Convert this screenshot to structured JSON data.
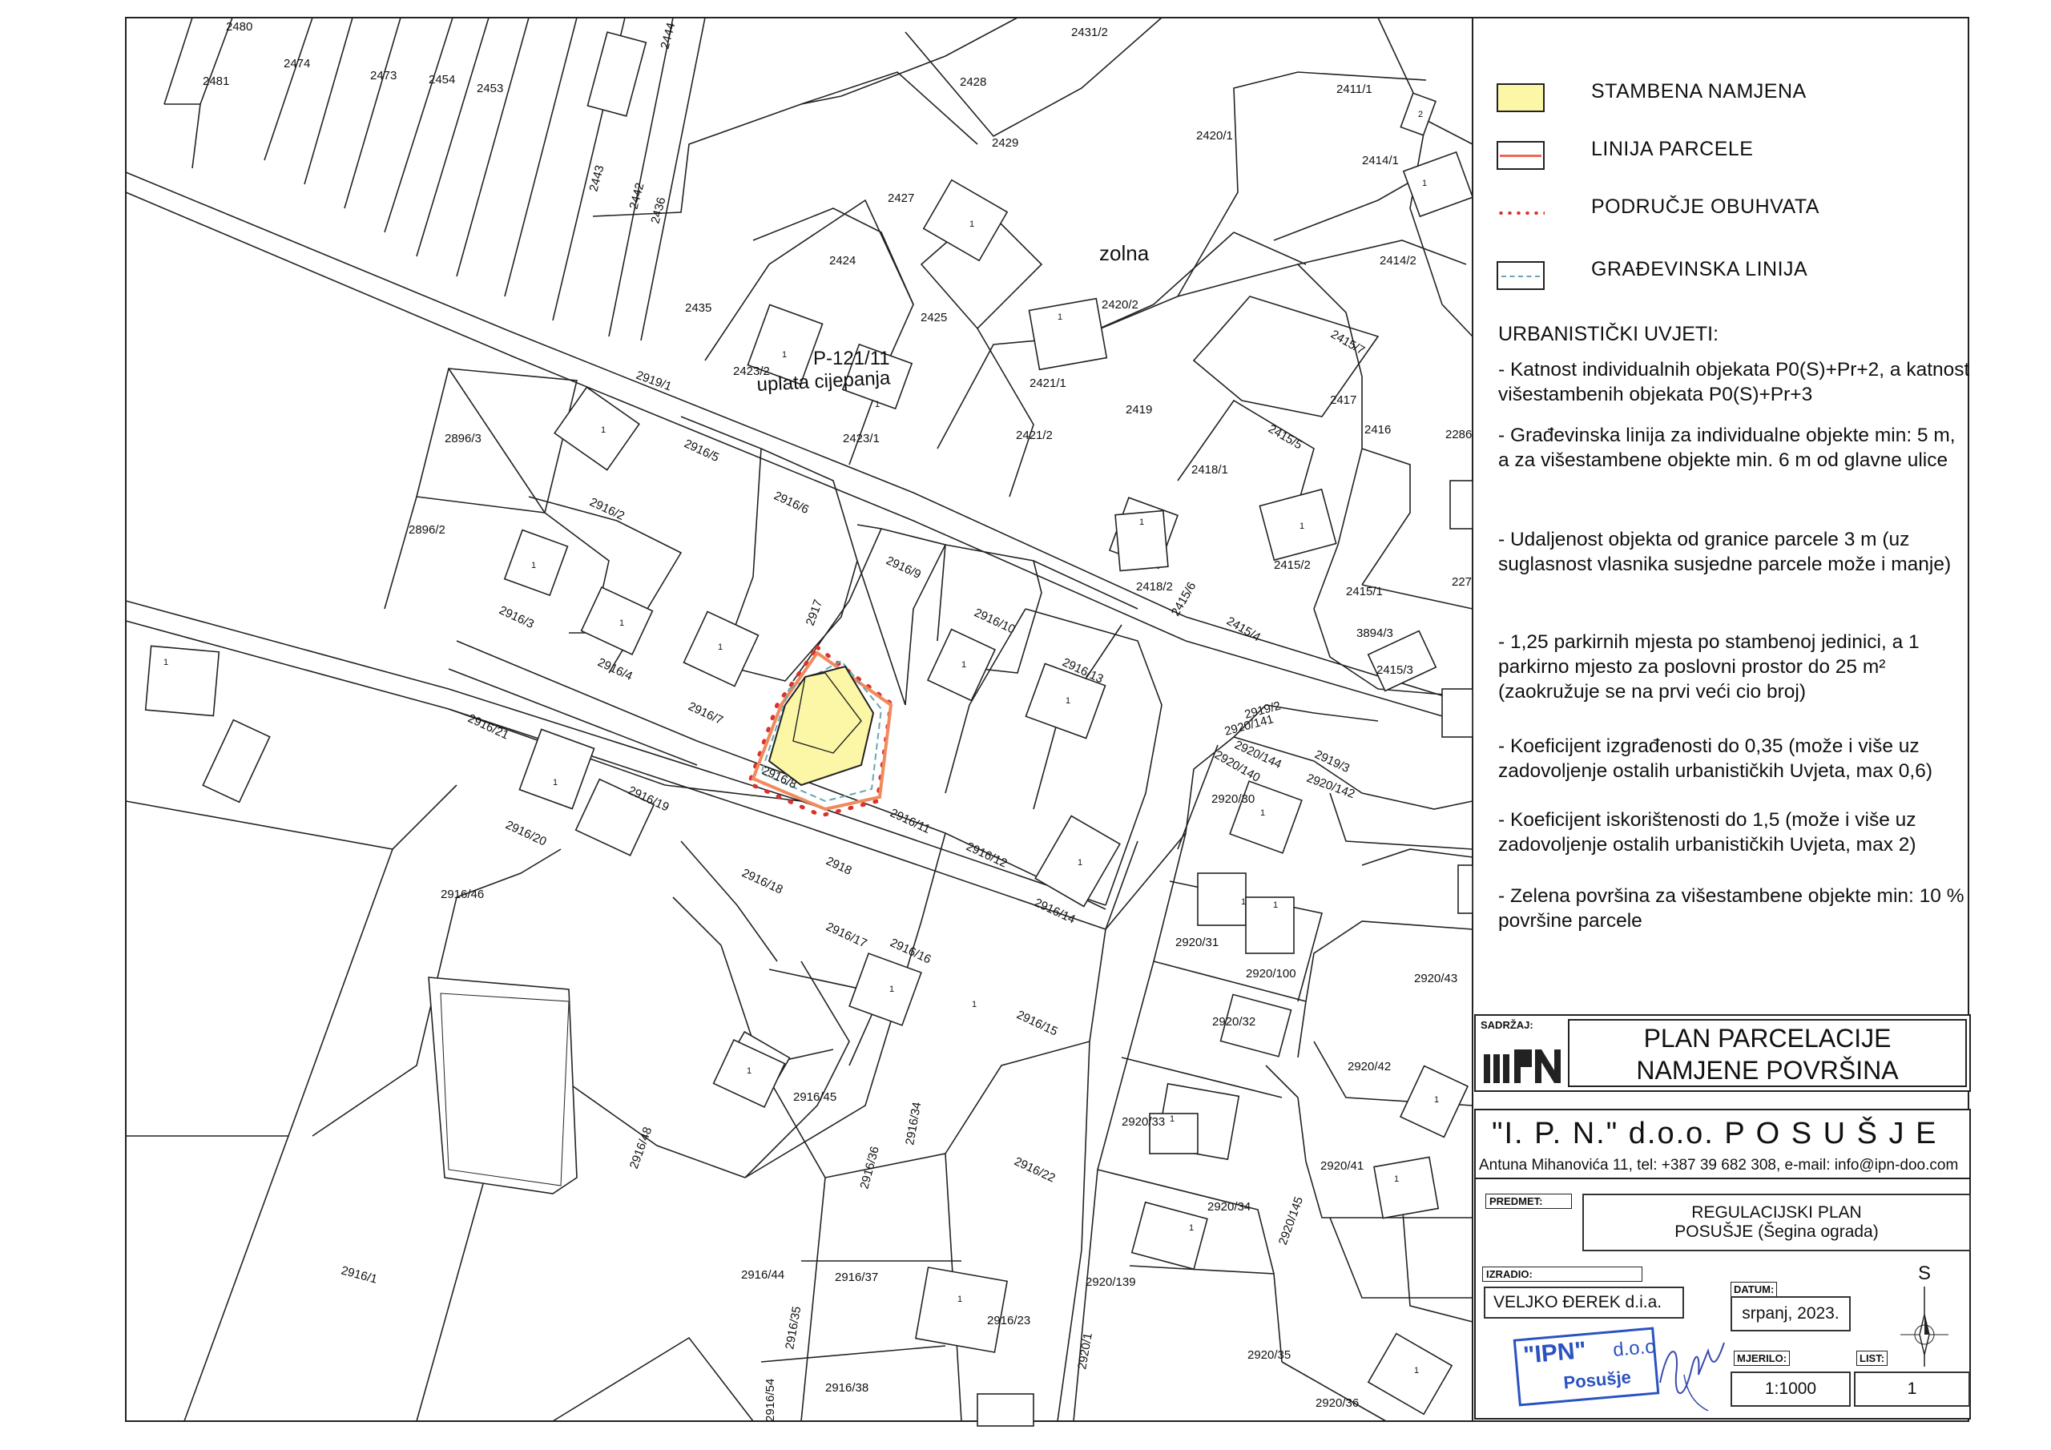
{
  "legend": {
    "items": [
      {
        "label": "STAMBENA NAMJENA",
        "symbol": "yellow-fill"
      },
      {
        "label": "LINIJA PARCELE",
        "symbol": "red-line"
      },
      {
        "label": "PODRUČJE OBUHVATA",
        "symbol": "red-dotted"
      },
      {
        "label": "GRAĐEVINSKA LINIJA",
        "symbol": "dashed-line"
      }
    ],
    "conditions_title": "URBANISTIČKI UVJETI:",
    "conditions": [
      "- Katnost individualnih objekata P0(S)+Pr+2, a katnost višestambenih objekata P0(S)+Pr+3",
      "- Građevinska linija za individualne objekte min: 5 m, a za višestambene objekte min. 6 m od glavne ulice",
      "- Udaljenost objekta od granice parcele 3 m (uz suglasnost vlasnika susjedne parcele može i manje)",
      "- 1,25 parkirnih mjesta po stambenoj jedinici, a 1 parkirno mjesto za poslovni prostor do 25 m² (zaokružuje se na prvi veći cio broj)",
      "- Koeficijent izgrađenosti do 0,35 (može i više uz zadovoljenje ostalih urbanističkih Uvjeta, max 0,6)",
      "- Koeficijent iskorištenosti do 1,5 (može i više uz zadovoljenje ostalih urbanističkih Uvjeta, max 2)",
      "- Zelena površina za višestambene objekte min: 10 % površine parcele"
    ]
  },
  "title_block": {
    "content_label": "SADRŽAJ:",
    "plan_title_1": "PLAN PARCELACIJE",
    "plan_title_2": "NAMJENE POVRŠINA",
    "company": "\"I. P. N.\"  d.o.o.  P O S U Š J E",
    "address": "Antuna Mihanovića 11,  tel: +387 39 682 308, e-mail: info@ipn-doo.com",
    "subject_label": "PREDMET:",
    "subject_1": "REGULACIJSKI PLAN",
    "subject_2": "POSUŠJE (Šegina ograda)",
    "author_label": "IZRADIO:",
    "author": "VELJKO ĐEREK d.i.a.",
    "date_label": "DATUM:",
    "date": "srpanj, 2023.",
    "scale_label": "MJERILO:",
    "scale": "1:1000",
    "sheet_label": "LIST:",
    "sheet": "1",
    "north_letter": "S",
    "stamp_1": "\"IPN\"",
    "stamp_2": "d.o.o",
    "stamp_3": "Posušje"
  },
  "map": {
    "handwritten_1": "P-121/11",
    "handwritten_2": "uplata cijepanja",
    "handwritten_3": "zolna",
    "parcels": [
      "2480",
      "2474",
      "2481",
      "2473",
      "2454",
      "2453",
      "2444",
      "2443",
      "2442",
      "2436",
      "2435",
      "2431/2",
      "2428",
      "2429",
      "2427",
      "2424",
      "2425",
      "2423/2",
      "2423/1",
      "2421/1",
      "2421/2",
      "2420/1",
      "2420/2",
      "2419",
      "2418/1",
      "2418/2",
      "2415/6",
      "2415/4",
      "2415/5",
      "2415/2",
      "2417",
      "2416",
      "2415/7",
      "2414/2",
      "2414/1",
      "2411/1",
      "2919/1",
      "2896/3",
      "2896/2",
      "2916/5",
      "2916/6",
      "2916/2",
      "2916/3",
      "2916/4",
      "2916/7",
      "2917",
      "2916/9",
      "2916/10",
      "2916/13",
      "2916/8",
      "2916/11",
      "2916/12",
      "2916/14",
      "2916/21",
      "2916/19",
      "2916/20",
      "2918",
      "2916/18",
      "2916/17",
      "2916/16",
      "2916/15",
      "2916/46",
      "2916/45",
      "2916/36",
      "2916/34",
      "2916/22",
      "2916/48",
      "2916/1",
      "2916/44",
      "2916/37",
      "2916/23",
      "2916/35",
      "2916/54",
      "2916/38",
      "2920/1",
      "2920/141",
      "2920/140",
      "2920/144",
      "2920/142",
      "2919/2",
      "2919/3",
      "2920/30",
      "2920/31",
      "2920/100",
      "2920/32",
      "2920/33",
      "2920/34",
      "2920/139",
      "2920/145",
      "2920/35",
      "2920/36",
      "2920/41",
      "2920/42",
      "2920/43",
      "2415/1",
      "2415/3",
      "3894/3",
      "2286",
      "227"
    ]
  }
}
